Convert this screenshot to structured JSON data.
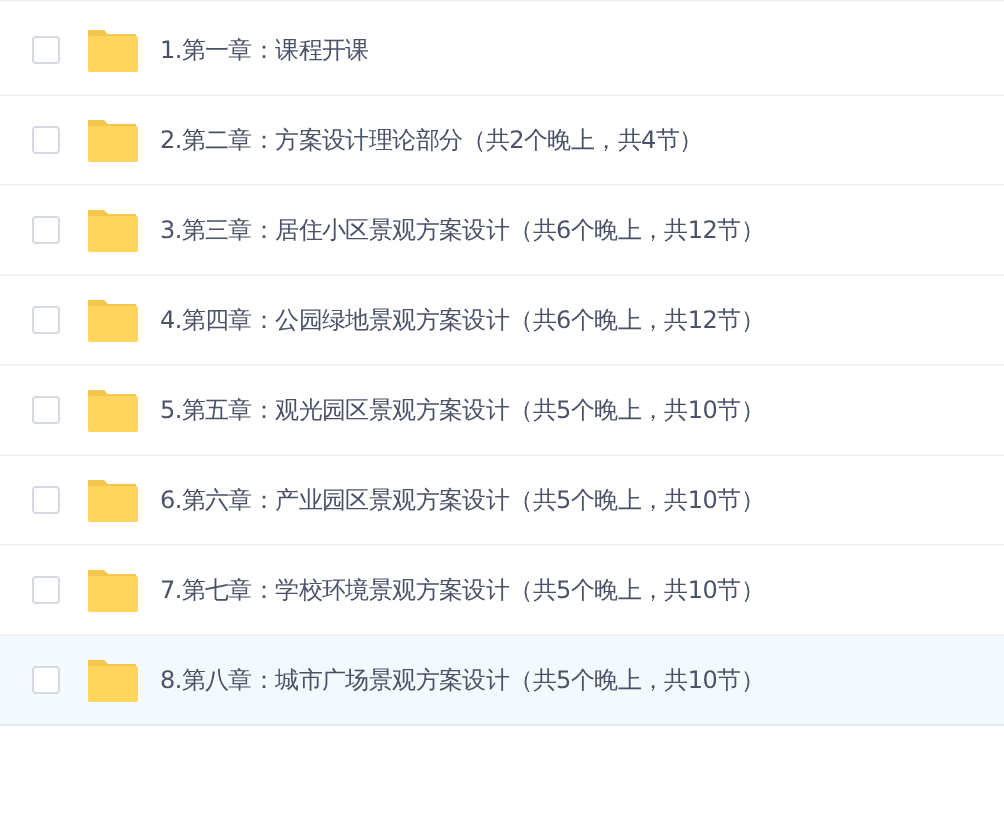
{
  "files": [
    {
      "name": "1.第一章：课程开课",
      "checked": false,
      "highlighted": false
    },
    {
      "name": "2.第二章：方案设计理论部分（共2个晚上，共4节）",
      "checked": false,
      "highlighted": false
    },
    {
      "name": "3.第三章：居住小区景观方案设计（共6个晚上，共12节）",
      "checked": false,
      "highlighted": false
    },
    {
      "name": "4.第四章：公园绿地景观方案设计（共6个晚上，共12节）",
      "checked": false,
      "highlighted": false
    },
    {
      "name": "5.第五章：观光园区景观方案设计（共5个晚上，共10节）",
      "checked": false,
      "highlighted": false
    },
    {
      "name": "6.第六章：产业园区景观方案设计（共5个晚上，共10节）",
      "checked": false,
      "highlighted": false
    },
    {
      "name": "7.第七章：学校环境景观方案设计（共5个晚上，共10节）",
      "checked": false,
      "highlighted": false
    },
    {
      "name": "8.第八章：城市广场景观方案设计（共5个晚上，共10节）",
      "checked": false,
      "highlighted": true
    }
  ]
}
